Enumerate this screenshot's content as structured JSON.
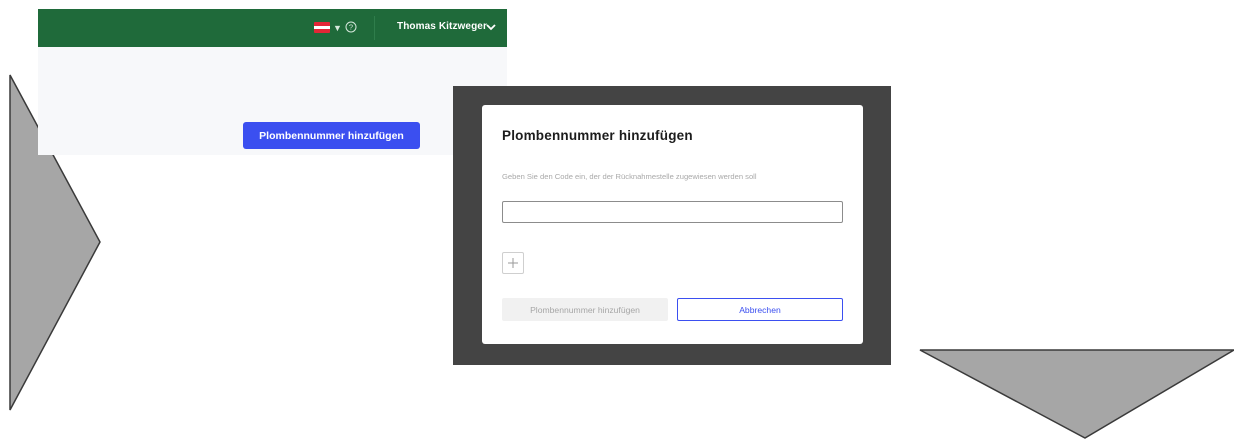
{
  "header": {
    "user_name": "Thomas Kitzweger",
    "language_flag": "austria-flag",
    "icons": [
      "chevron-down-icon",
      "help-icon",
      "chevron-down-icon"
    ]
  },
  "page": {
    "primary_button_label": "Plombennummer hinzufügen"
  },
  "modal": {
    "title": "Plombennummer hinzufügen",
    "hint": "Geben Sie den Code ein, der der Rücknahmestelle zugewiesen werden soll",
    "code_input": {
      "value": "",
      "placeholder": ""
    },
    "add_icon": "plus-icon",
    "submit_label": "Plombennummer hinzufügen",
    "cancel_label": "Abbrechen"
  },
  "colors": {
    "header_green": "#1f6a3a",
    "primary_blue": "#3b4ff0",
    "overlay": "#444444",
    "arrow_fill": "#a6a6a6"
  }
}
